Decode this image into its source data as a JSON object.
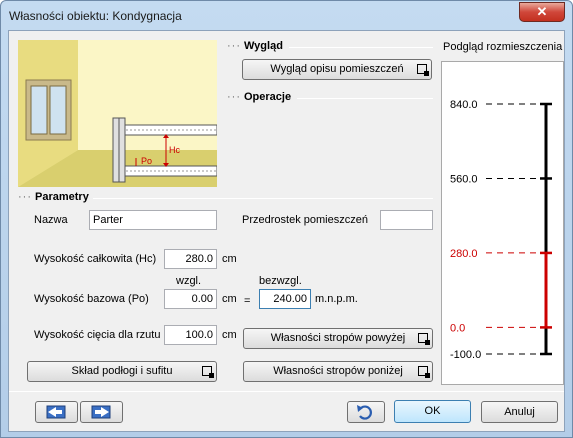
{
  "window": {
    "title": "Własności obiektu: Kondygnacja",
    "close_glyph": "✕"
  },
  "sections": {
    "wyglad": "Wygląd",
    "operacje": "Operacje",
    "parametry": "Parametry",
    "dots": "···"
  },
  "buttons": {
    "wyglad_opisu": "Wygląd opisu pomieszczeń",
    "sklad_podlogi": "Skład podłogi i sufitu",
    "stropy_powyzej": "Własności stropów powyżej",
    "stropy_ponizej": "Własności stropów poniżej",
    "ok": "OK",
    "anuluj": "Anuluj"
  },
  "fields": {
    "nazwa_label": "Nazwa",
    "nazwa_value": "Parter",
    "przedrostek_label": "Przedrostek pomieszczeń",
    "przedrostek_value": "",
    "wys_calkowita_label": "Wysokość całkowita (Hc)",
    "wys_calkowita_value": "280.0",
    "wys_bazowa_label": "Wysokość bazowa (Po)",
    "wys_bazowa_value": "0.00",
    "wzgl_label": "wzgl.",
    "bezwzgl_label": "bezwzgl.",
    "bezwzgl_value": "240.00",
    "equals": "=",
    "mnpm": "m.n.p.m.",
    "wys_ciecia_label": "Wysokość cięcia dla rzutu",
    "wys_ciecia_value": "100.0",
    "unit_cm": "cm"
  },
  "illustration": {
    "hc_label": "Hc",
    "po_label": "Po"
  },
  "preview": {
    "title": "Podgląd rozmieszczenia",
    "levels": [
      {
        "label": "840.0",
        "value": 840,
        "color": "#000000"
      },
      {
        "label": "560.0",
        "value": 560,
        "color": "#000000"
      },
      {
        "label": "280.0",
        "value": 280,
        "color": "#cc0000"
      },
      {
        "label": "0.0",
        "value": 0,
        "color": "#cc0000"
      },
      {
        "label": "-100.0",
        "value": -100,
        "color": "#000000"
      }
    ],
    "highlight_range": [
      0,
      280
    ]
  }
}
